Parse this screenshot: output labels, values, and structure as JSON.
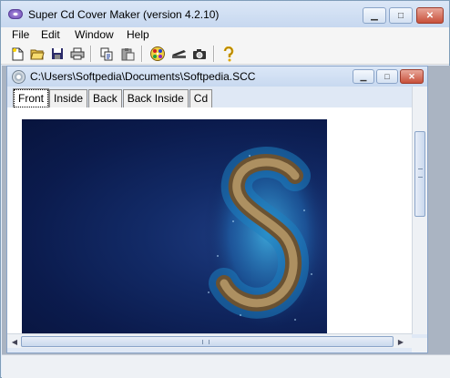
{
  "window": {
    "title": "Super Cd Cover Maker (version 4.2.10)",
    "accent": "#c6d7ef"
  },
  "caption_buttons": {
    "minimize_icon": "minimize-icon",
    "maximize_icon": "maximize-icon",
    "close_icon": "close-icon"
  },
  "menu": [
    "File",
    "Edit",
    "Window",
    "Help"
  ],
  "toolbar": {
    "buttons": [
      "new-file-icon",
      "open-folder-icon",
      "save-icon",
      "print-icon",
      "copy-icon",
      "paste-icon",
      "disc-palette-icon",
      "scanner-icon",
      "camera-icon",
      "help-icon"
    ]
  },
  "document": {
    "title": "C:\\Users\\Softpedia\\Documents\\Softpedia.SCC",
    "tabs": [
      "Front",
      "Inside",
      "Back",
      "Back Inside",
      "Cd"
    ],
    "active_tab": "Front",
    "cover_background": "#0b1b4d"
  },
  "scroll": {
    "h_grip": "III",
    "v_grip": "≡"
  }
}
